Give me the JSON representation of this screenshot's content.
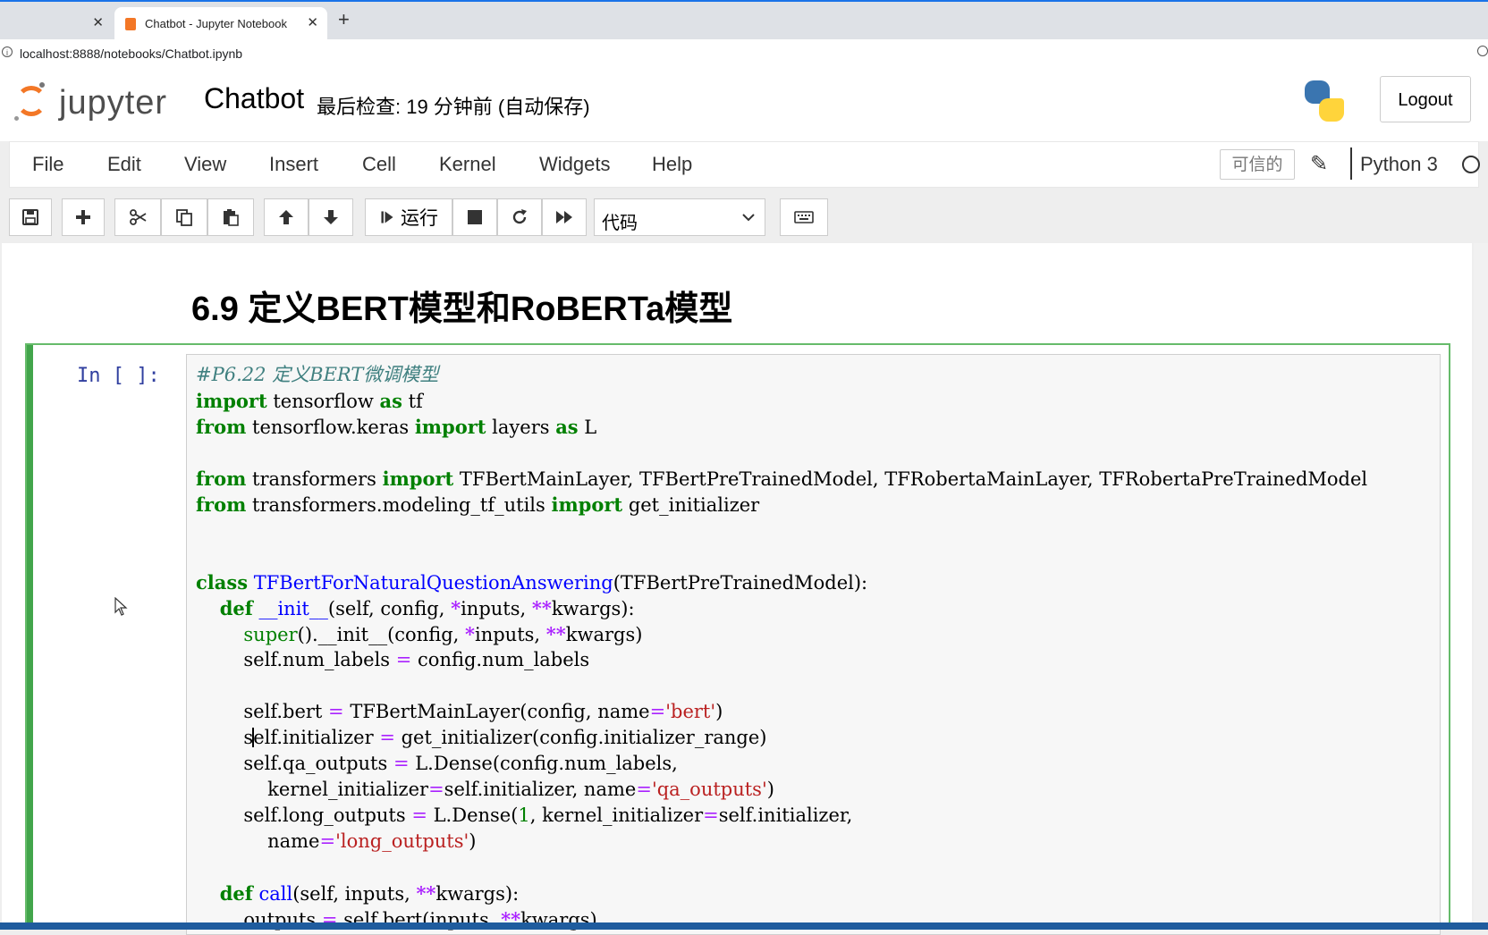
{
  "browser": {
    "tabs": [
      {
        "title": "",
        "active": false
      },
      {
        "title": "Chatbot - Jupyter Notebook",
        "active": true
      }
    ],
    "url": "localhost:8888/notebooks/Chatbot.ipynb"
  },
  "header": {
    "logo_text": "jupyter",
    "notebook_name": "Chatbot",
    "checkpoint": "最后检查: 19 分钟前  (自动保存)",
    "logout_label": "Logout"
  },
  "menubar": {
    "items": [
      "File",
      "Edit",
      "View",
      "Insert",
      "Cell",
      "Kernel",
      "Widgets",
      "Help"
    ],
    "trusted_label": "可信的",
    "kernel_name": "Python 3"
  },
  "toolbar": {
    "run_label": "运行",
    "cell_type": "代码",
    "icons": [
      "save-icon",
      "plus-icon",
      "scissors-icon",
      "copy-icon",
      "paste-icon",
      "arrow-up-icon",
      "arrow-down-icon",
      "run-icon",
      "stop-icon",
      "restart-icon",
      "fast-forward-icon",
      "chevron-down-icon",
      "keyboard-icon"
    ]
  },
  "notebook": {
    "heading": "6.9 定义BERT模型和RoBERTa模型",
    "cell_prompt": "In  [  ]:",
    "code_lines": [
      "#P6.22 定义BERT微调模型",
      "import tensorflow as tf",
      "from tensorflow.keras import layers as L",
      "",
      "from transformers import TFBertMainLayer, TFBertPreTrainedModel, TFRobertaMainLayer, TFRobertaPreTrainedModel",
      "from transformers.modeling_tf_utils import get_initializer",
      "",
      "",
      "class TFBertForNaturalQuestionAnswering(TFBertPreTrainedModel):",
      "    def __init__(self, config, *inputs, **kwargs):",
      "        super().__init__(config, *inputs, **kwargs)",
      "        self.num_labels = config.num_labels",
      "",
      "        self.bert = TFBertMainLayer(config, name='bert')",
      "        self.initializer = get_initializer(config.initializer_range)",
      "        self.qa_outputs = L.Dense(config.num_labels,",
      "            kernel_initializer=self.initializer, name='qa_outputs')",
      "        self.long_outputs = L.Dense(1, kernel_initializer=self.initializer,",
      "            name='long_outputs')",
      "",
      "    def call(self, inputs, **kwargs):",
      "        outputs = self.bert(inputs, **kwargs)"
    ]
  }
}
